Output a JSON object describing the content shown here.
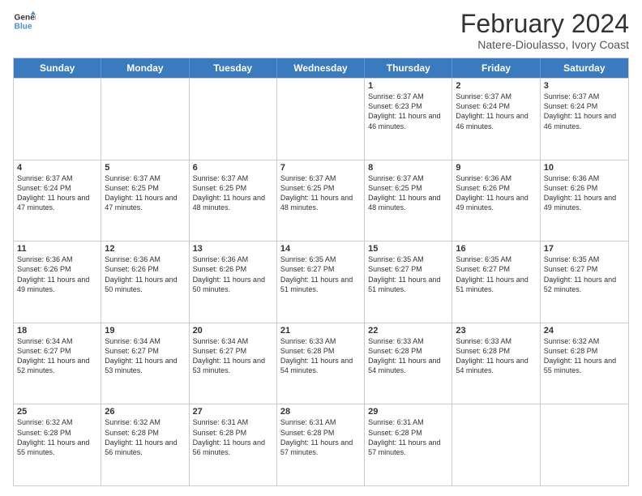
{
  "logo": {
    "line1": "General",
    "line2": "Blue"
  },
  "title": "February 2024",
  "subtitle": "Natere-Dioulasso, Ivory Coast",
  "days": [
    "Sunday",
    "Monday",
    "Tuesday",
    "Wednesday",
    "Thursday",
    "Friday",
    "Saturday"
  ],
  "rows": [
    [
      {
        "num": "",
        "info": ""
      },
      {
        "num": "",
        "info": ""
      },
      {
        "num": "",
        "info": ""
      },
      {
        "num": "",
        "info": ""
      },
      {
        "num": "1",
        "info": "Sunrise: 6:37 AM\nSunset: 6:23 PM\nDaylight: 11 hours and 46 minutes."
      },
      {
        "num": "2",
        "info": "Sunrise: 6:37 AM\nSunset: 6:24 PM\nDaylight: 11 hours and 46 minutes."
      },
      {
        "num": "3",
        "info": "Sunrise: 6:37 AM\nSunset: 6:24 PM\nDaylight: 11 hours and 46 minutes."
      }
    ],
    [
      {
        "num": "4",
        "info": "Sunrise: 6:37 AM\nSunset: 6:24 PM\nDaylight: 11 hours and 47 minutes."
      },
      {
        "num": "5",
        "info": "Sunrise: 6:37 AM\nSunset: 6:25 PM\nDaylight: 11 hours and 47 minutes."
      },
      {
        "num": "6",
        "info": "Sunrise: 6:37 AM\nSunset: 6:25 PM\nDaylight: 11 hours and 48 minutes."
      },
      {
        "num": "7",
        "info": "Sunrise: 6:37 AM\nSunset: 6:25 PM\nDaylight: 11 hours and 48 minutes."
      },
      {
        "num": "8",
        "info": "Sunrise: 6:37 AM\nSunset: 6:25 PM\nDaylight: 11 hours and 48 minutes."
      },
      {
        "num": "9",
        "info": "Sunrise: 6:36 AM\nSunset: 6:26 PM\nDaylight: 11 hours and 49 minutes."
      },
      {
        "num": "10",
        "info": "Sunrise: 6:36 AM\nSunset: 6:26 PM\nDaylight: 11 hours and 49 minutes."
      }
    ],
    [
      {
        "num": "11",
        "info": "Sunrise: 6:36 AM\nSunset: 6:26 PM\nDaylight: 11 hours and 49 minutes."
      },
      {
        "num": "12",
        "info": "Sunrise: 6:36 AM\nSunset: 6:26 PM\nDaylight: 11 hours and 50 minutes."
      },
      {
        "num": "13",
        "info": "Sunrise: 6:36 AM\nSunset: 6:26 PM\nDaylight: 11 hours and 50 minutes."
      },
      {
        "num": "14",
        "info": "Sunrise: 6:35 AM\nSunset: 6:27 PM\nDaylight: 11 hours and 51 minutes."
      },
      {
        "num": "15",
        "info": "Sunrise: 6:35 AM\nSunset: 6:27 PM\nDaylight: 11 hours and 51 minutes."
      },
      {
        "num": "16",
        "info": "Sunrise: 6:35 AM\nSunset: 6:27 PM\nDaylight: 11 hours and 51 minutes."
      },
      {
        "num": "17",
        "info": "Sunrise: 6:35 AM\nSunset: 6:27 PM\nDaylight: 11 hours and 52 minutes."
      }
    ],
    [
      {
        "num": "18",
        "info": "Sunrise: 6:34 AM\nSunset: 6:27 PM\nDaylight: 11 hours and 52 minutes."
      },
      {
        "num": "19",
        "info": "Sunrise: 6:34 AM\nSunset: 6:27 PM\nDaylight: 11 hours and 53 minutes."
      },
      {
        "num": "20",
        "info": "Sunrise: 6:34 AM\nSunset: 6:27 PM\nDaylight: 11 hours and 53 minutes."
      },
      {
        "num": "21",
        "info": "Sunrise: 6:33 AM\nSunset: 6:28 PM\nDaylight: 11 hours and 54 minutes."
      },
      {
        "num": "22",
        "info": "Sunrise: 6:33 AM\nSunset: 6:28 PM\nDaylight: 11 hours and 54 minutes."
      },
      {
        "num": "23",
        "info": "Sunrise: 6:33 AM\nSunset: 6:28 PM\nDaylight: 11 hours and 54 minutes."
      },
      {
        "num": "24",
        "info": "Sunrise: 6:32 AM\nSunset: 6:28 PM\nDaylight: 11 hours and 55 minutes."
      }
    ],
    [
      {
        "num": "25",
        "info": "Sunrise: 6:32 AM\nSunset: 6:28 PM\nDaylight: 11 hours and 55 minutes."
      },
      {
        "num": "26",
        "info": "Sunrise: 6:32 AM\nSunset: 6:28 PM\nDaylight: 11 hours and 56 minutes."
      },
      {
        "num": "27",
        "info": "Sunrise: 6:31 AM\nSunset: 6:28 PM\nDaylight: 11 hours and 56 minutes."
      },
      {
        "num": "28",
        "info": "Sunrise: 6:31 AM\nSunset: 6:28 PM\nDaylight: 11 hours and 57 minutes."
      },
      {
        "num": "29",
        "info": "Sunrise: 6:31 AM\nSunset: 6:28 PM\nDaylight: 11 hours and 57 minutes."
      },
      {
        "num": "",
        "info": ""
      },
      {
        "num": "",
        "info": ""
      }
    ]
  ]
}
